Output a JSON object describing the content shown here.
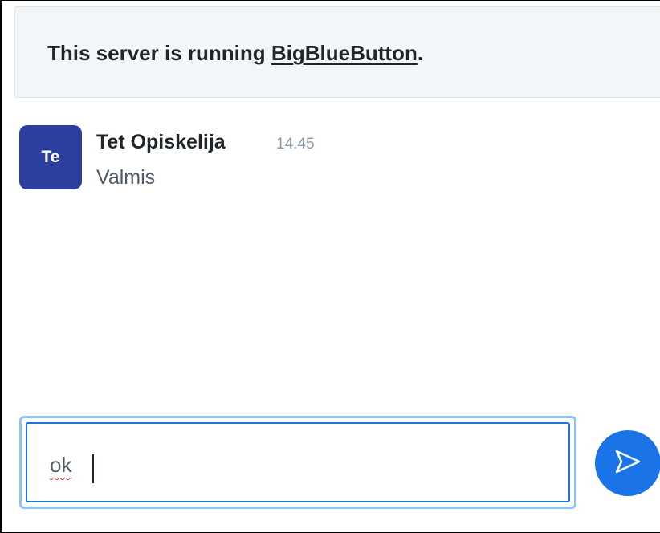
{
  "welcome": {
    "prefix": "This server is running ",
    "link_text": "BigBlueButton",
    "suffix": "."
  },
  "messages": [
    {
      "avatar_initials": "Te",
      "avatar_color": "#2c3e9e",
      "sender": "Tet Opiskelija",
      "time": "14.45",
      "text": "Valmis"
    }
  ],
  "composer": {
    "value": "ok",
    "send_icon": "send-icon",
    "accent_color": "#1b73e8"
  }
}
